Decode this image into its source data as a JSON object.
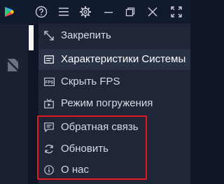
{
  "titlebar": {
    "icons": [
      "play-store-icon",
      "help-icon",
      "menu-icon",
      "gear-icon",
      "minimize-icon",
      "restore-icon",
      "close-icon",
      "fullscreen-icon"
    ]
  },
  "menu": {
    "items": [
      {
        "label": "Закрепить",
        "icon": "pin-icon"
      },
      {
        "label": "Характеристики Системы",
        "icon": "system-info-icon"
      },
      {
        "label": "Скрыть FPS",
        "icon": "fps-icon"
      },
      {
        "label": "Режим погружения",
        "icon": "immersive-mode-icon"
      },
      {
        "label": "Обратная связь",
        "icon": "feedback-icon"
      },
      {
        "label": "Обновить",
        "icon": "refresh-icon"
      },
      {
        "label": "О нас",
        "icon": "info-icon"
      }
    ]
  },
  "colors": {
    "titlebar_bg": "#111a2e",
    "menu_bg": "#1e2638",
    "menu_hover": "#2a3247",
    "highlight_border": "#e11b22"
  }
}
